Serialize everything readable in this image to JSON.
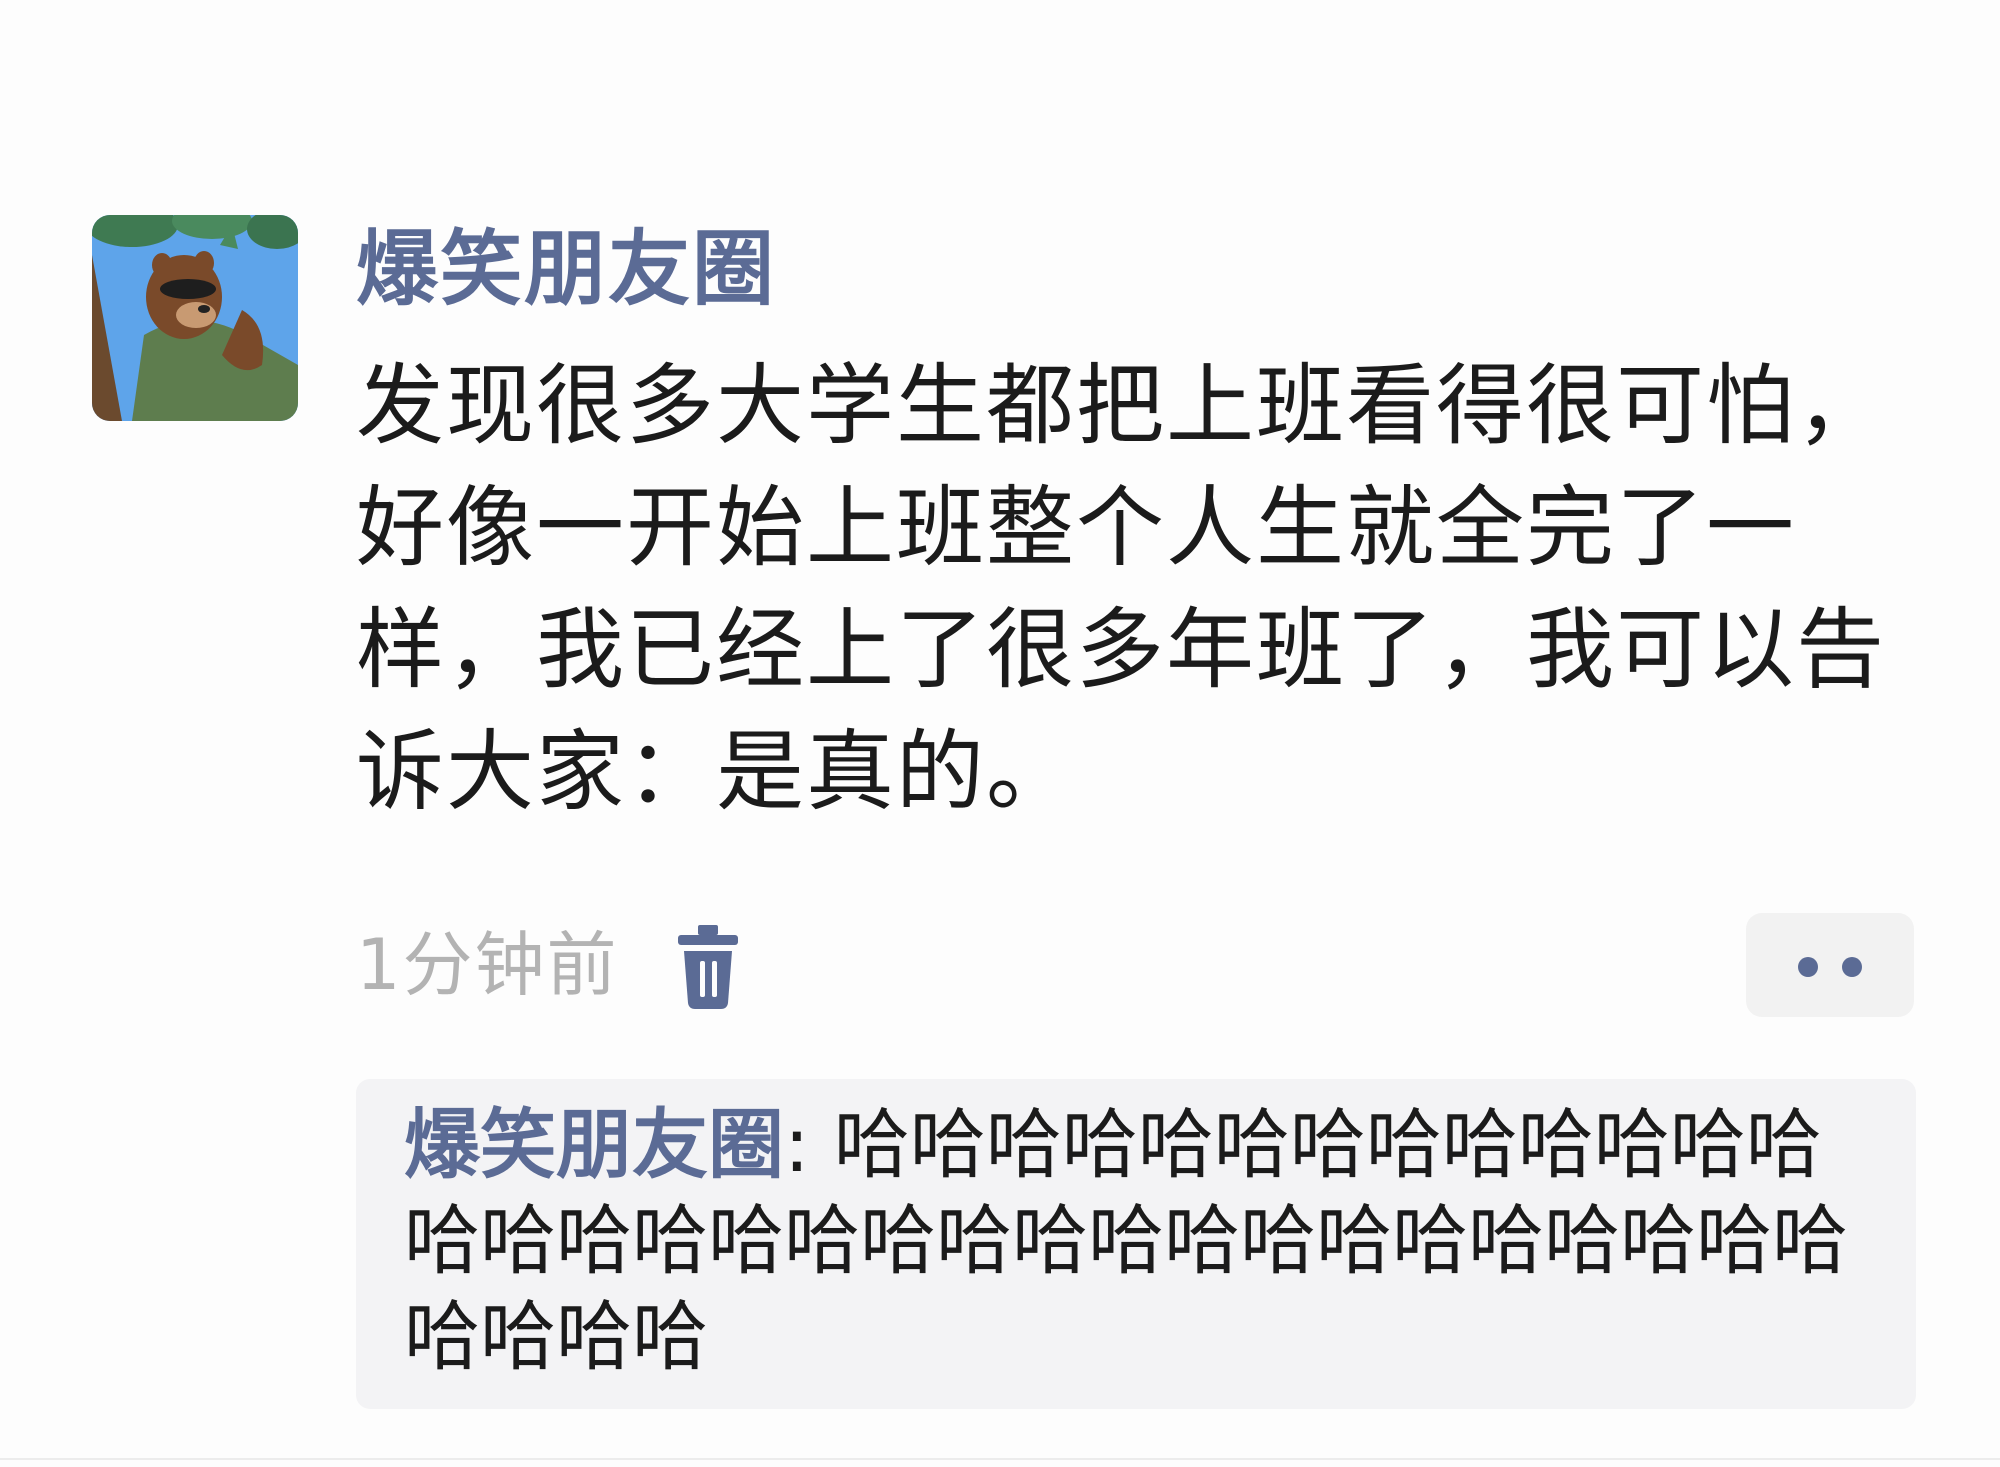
{
  "post": {
    "author": "爆笑朋友圈",
    "avatar_icon": "cartoon-bear-avatar",
    "text": "发现很多大学生都把上班看得很可怕，好像一开始上班整个人生就全完了一样，我已经上了很多年班了，我可以告诉大家：是真的。",
    "time": "1分钟前",
    "delete_icon": "trash-icon",
    "more_icon": "more-dots-icon"
  },
  "comments": [
    {
      "author": "爆笑朋友圈",
      "separator": ": ",
      "text": "哈哈哈哈哈哈哈哈哈哈哈哈哈哈哈哈哈哈哈哈哈哈哈哈哈哈哈哈哈哈哈哈哈哈哈哈"
    }
  ],
  "colors": {
    "name_link": "#5b6b95",
    "body_text": "#1b1b1b",
    "timestamp": "#b3b3b3",
    "comment_bg": "#f3f3f5",
    "page_bg": "#fdfdfd"
  }
}
